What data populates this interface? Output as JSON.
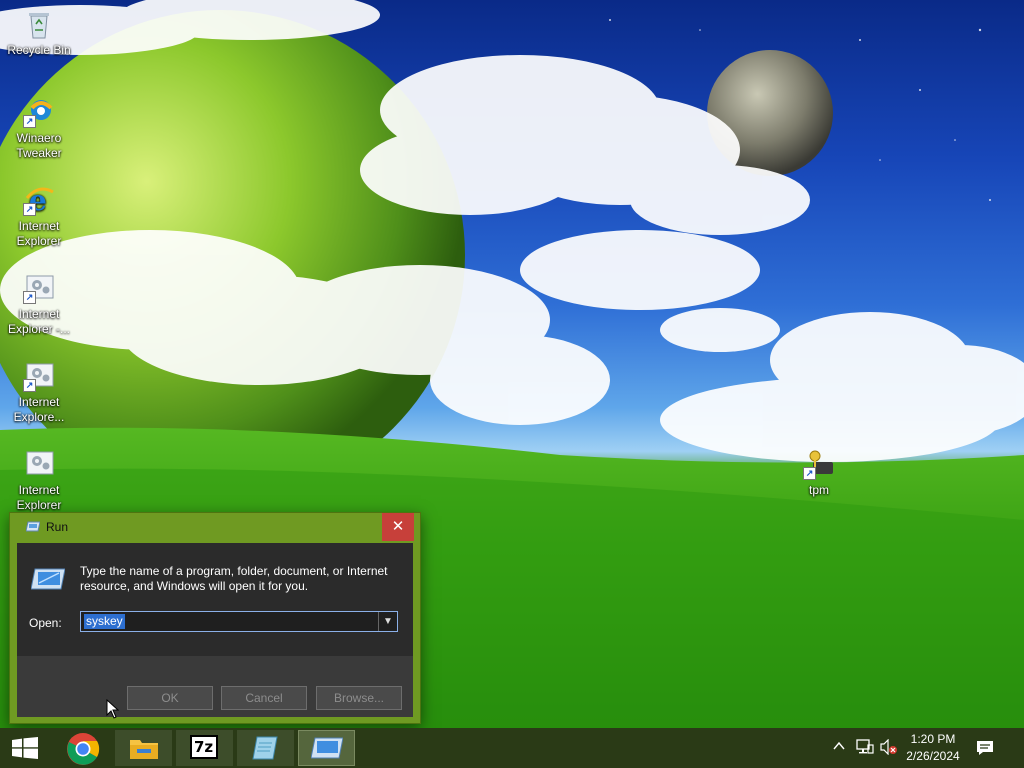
{
  "desktop": {
    "icons": [
      {
        "label": "Recycle Bin",
        "icon": "recycle-bin-icon"
      },
      {
        "label": "Winaero Tweaker",
        "icon": "winaero-tweaker-icon"
      },
      {
        "label": "Internet Explorer",
        "icon": "internet-explorer-icon"
      },
      {
        "label": "Internet Explorer -...",
        "icon": "settings-shortcut-icon"
      },
      {
        "label": "Internet Explore...",
        "icon": "settings-shortcut-icon"
      },
      {
        "label": "Internet Explorer",
        "icon": "settings-shortcut-icon"
      },
      {
        "label": "tpm",
        "icon": "tpm-key-icon"
      }
    ]
  },
  "run_dialog": {
    "title": "Run",
    "description": "Type the name of a program, folder, document, or Internet resource, and Windows will open it for you.",
    "open_label": "Open:",
    "open_value": "syskey",
    "ok_label": "OK",
    "cancel_label": "Cancel",
    "browse_label": "Browse...",
    "close_glyph": "✕"
  },
  "taskbar": {
    "apps": [
      {
        "name": "start",
        "icon": "windows-logo-icon"
      },
      {
        "name": "chrome",
        "icon": "chrome-icon"
      },
      {
        "name": "file-explorer",
        "icon": "folder-icon"
      },
      {
        "name": "7zip",
        "icon": "7zip-icon",
        "text": "7z"
      },
      {
        "name": "notepad",
        "icon": "notepad-icon"
      },
      {
        "name": "run",
        "icon": "run-icon"
      }
    ],
    "time": "1:20 PM",
    "date": "2/26/2024"
  },
  "colors": {
    "accent": "#6f9a22",
    "taskbar": "#2a3a16",
    "close": "#c7403a",
    "selection": "#2d6fd0"
  }
}
